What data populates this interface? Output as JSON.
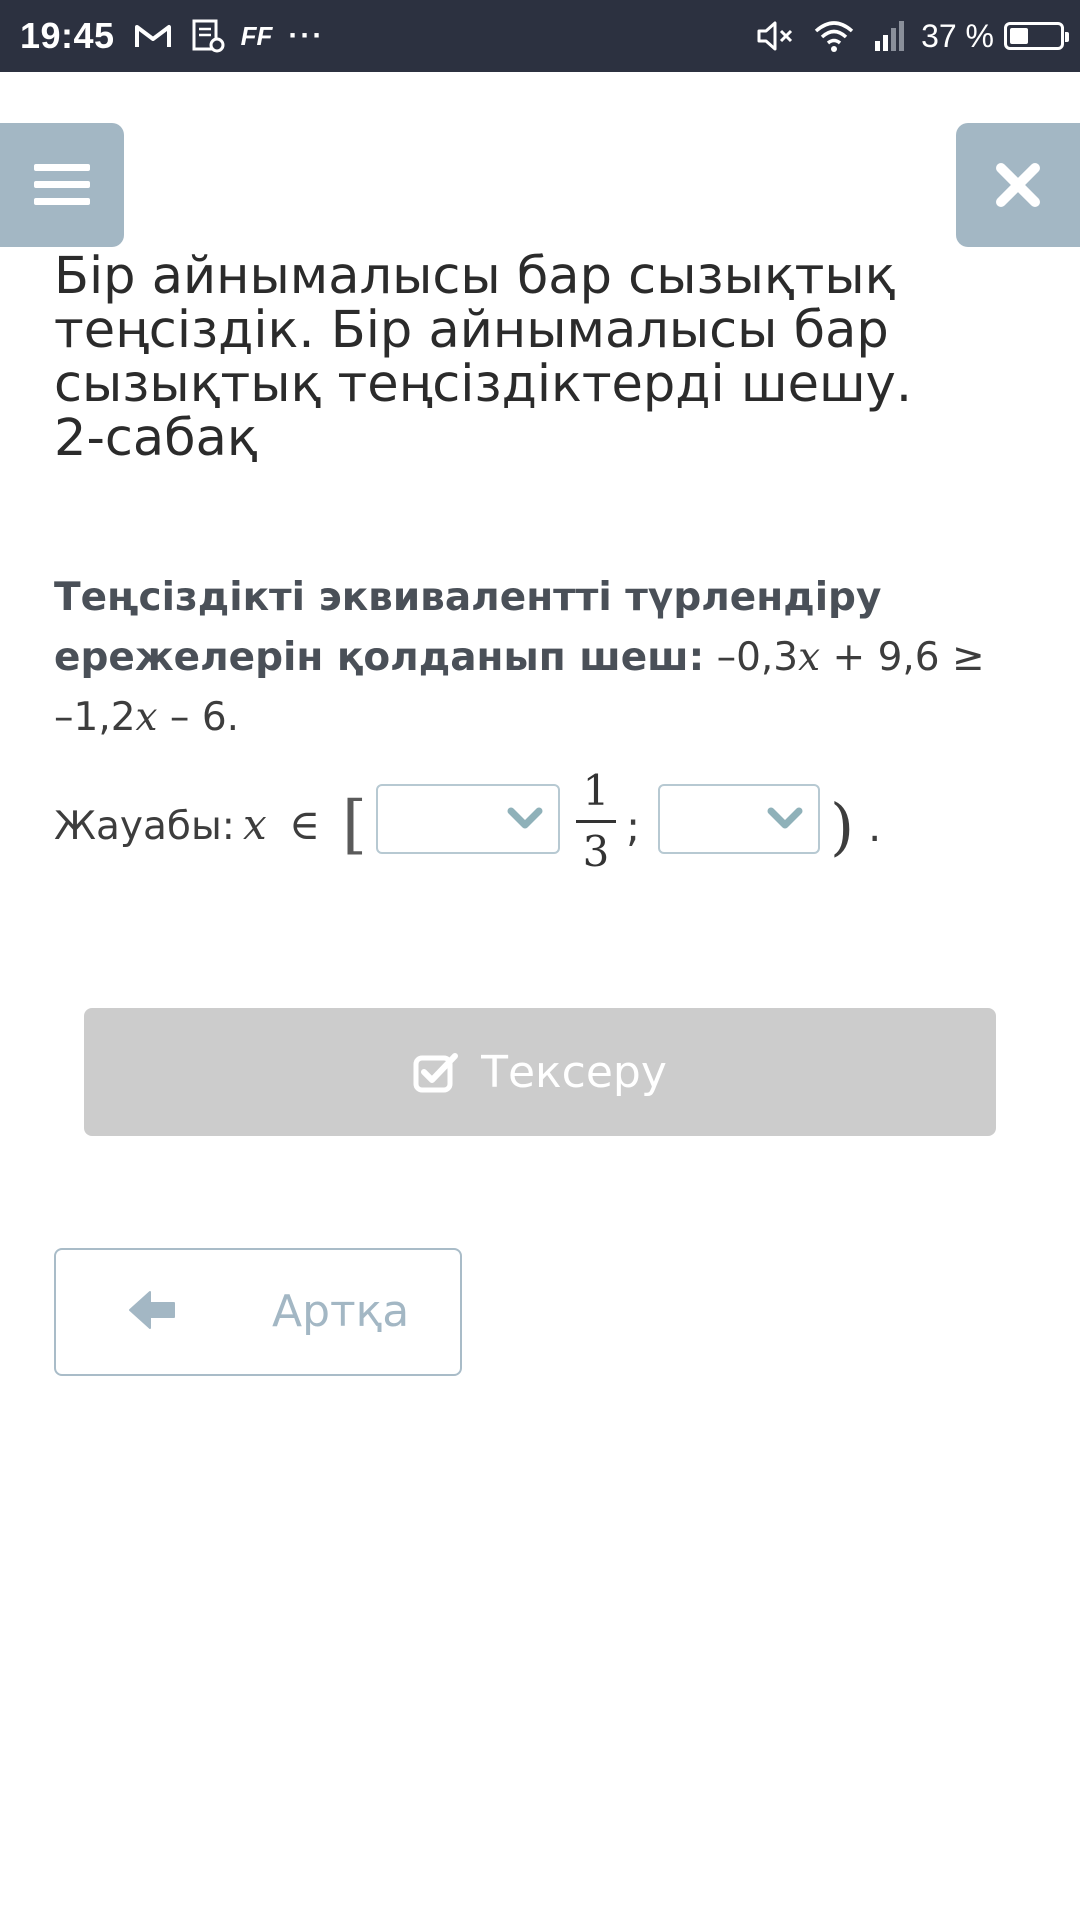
{
  "status_bar": {
    "time": "19:45",
    "app_icons": [
      "gmail-icon",
      "document-settings-icon",
      "ff-icon"
    ],
    "ff_label": "FF",
    "more_label": "···",
    "battery_text": "37 %",
    "battery_level": 0.37
  },
  "header": {
    "menu_icon": "hamburger-icon",
    "close_icon": "close-icon",
    "accent_color": "#a3b7c4"
  },
  "lesson": {
    "title": "Бір айнымалысы бар сызықтық теңсіздік. Бір айнымалысы бар сызықтық теңсіздіктерді шешу. 2-сабақ"
  },
  "question": {
    "instruction": "Теңсіздікті эквивалентті түрлендіру ережелерін қолданып шеш:",
    "expr_part1": " –0,3",
    "var": "x",
    "expr_part2": " + 9,6 ≥ –1,2",
    "expr_part3": " – 6."
  },
  "answer": {
    "label": "Жауабы:",
    "variable": "x",
    "symbol": "∈",
    "open_bracket": "[",
    "dropdown1_value": "",
    "fraction_numerator": "1",
    "fraction_denominator": "3",
    "separator": ";",
    "dropdown2_value": "",
    "close_bracket": ")",
    "end": "."
  },
  "buttons": {
    "check_label": "Тексеру",
    "back_label": "Артқа",
    "check_bg": "#cccccc"
  }
}
